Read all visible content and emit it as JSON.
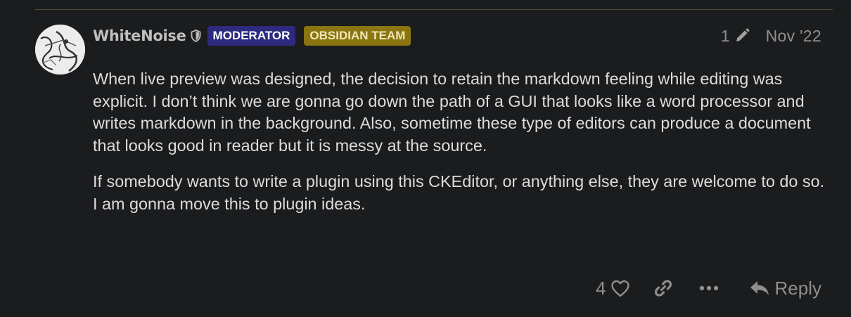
{
  "post": {
    "author": {
      "username": "WhiteNoise",
      "badges": [
        {
          "label": "MODERATOR",
          "color": "#2e2a80"
        },
        {
          "label": "OBSIDIAN TEAM",
          "color": "#8a7511"
        }
      ]
    },
    "edit_count": "1",
    "date": "Nov '22",
    "paragraphs": [
      "When live preview was designed, the decision to retain the markdown feeling while editing was explicit. I don’t think we are gonna go down the path of a GUI that looks like a word processor and writes markdown in the background. Also, sometime these type of editors can produce a document that looks good in reader but it is messy at the source.",
      "If somebody wants to write a plugin using this CKEditor, or anything else, they are welcome to do so. I am gonna move this to plugin ideas."
    ],
    "actions": {
      "like_count": "4",
      "reply_label": "Reply"
    },
    "icons": {
      "shield": "shield-icon",
      "edit": "pencil-icon",
      "like": "heart-icon",
      "link": "link-icon",
      "more": "ellipsis-icon",
      "reply": "reply-arrow-icon"
    }
  }
}
